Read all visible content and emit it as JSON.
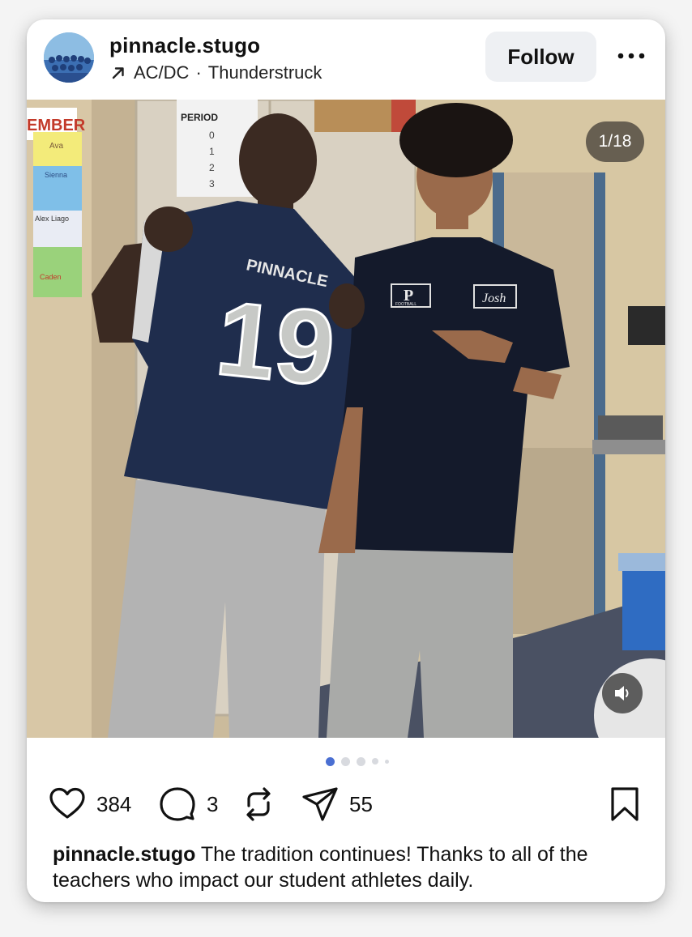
{
  "post": {
    "username": "pinnacle.stugo",
    "audio": {
      "artist": "AC/DC",
      "separator": "·",
      "track": "Thunderstruck"
    },
    "follow_label": "Follow",
    "media_counter": "1/18",
    "caption_user": "pinnacle.stugo",
    "caption_text": "The tradition continues! Thanks to all of the teachers who impact our student athletes daily."
  },
  "actions": {
    "likes": "384",
    "comments": "3",
    "shares": "55"
  },
  "photo_text": {
    "banner": "EMBER",
    "chart_header": "PERIOD",
    "chart_rows": [
      "0",
      "1",
      "2",
      "3"
    ],
    "card_names": [
      "Ava",
      "Sienna",
      "Alex Liago",
      "Caden"
    ],
    "jersey_word": "PINNACLE",
    "jersey_number": "19",
    "shirt_logo": "P",
    "shirt_logo_sub": "FOOTBALL",
    "name_patch": "Josh"
  },
  "icons": {
    "audio": "arrow-up-right-icon",
    "more": "more-horizontal-icon",
    "volume": "volume-icon",
    "like": "heart-icon",
    "comment": "comment-icon",
    "repost": "repost-icon",
    "share": "send-icon",
    "save": "bookmark-icon"
  },
  "colors": {
    "accent_dot": "#4a6fd2",
    "follow_bg": "#eef0f3"
  }
}
